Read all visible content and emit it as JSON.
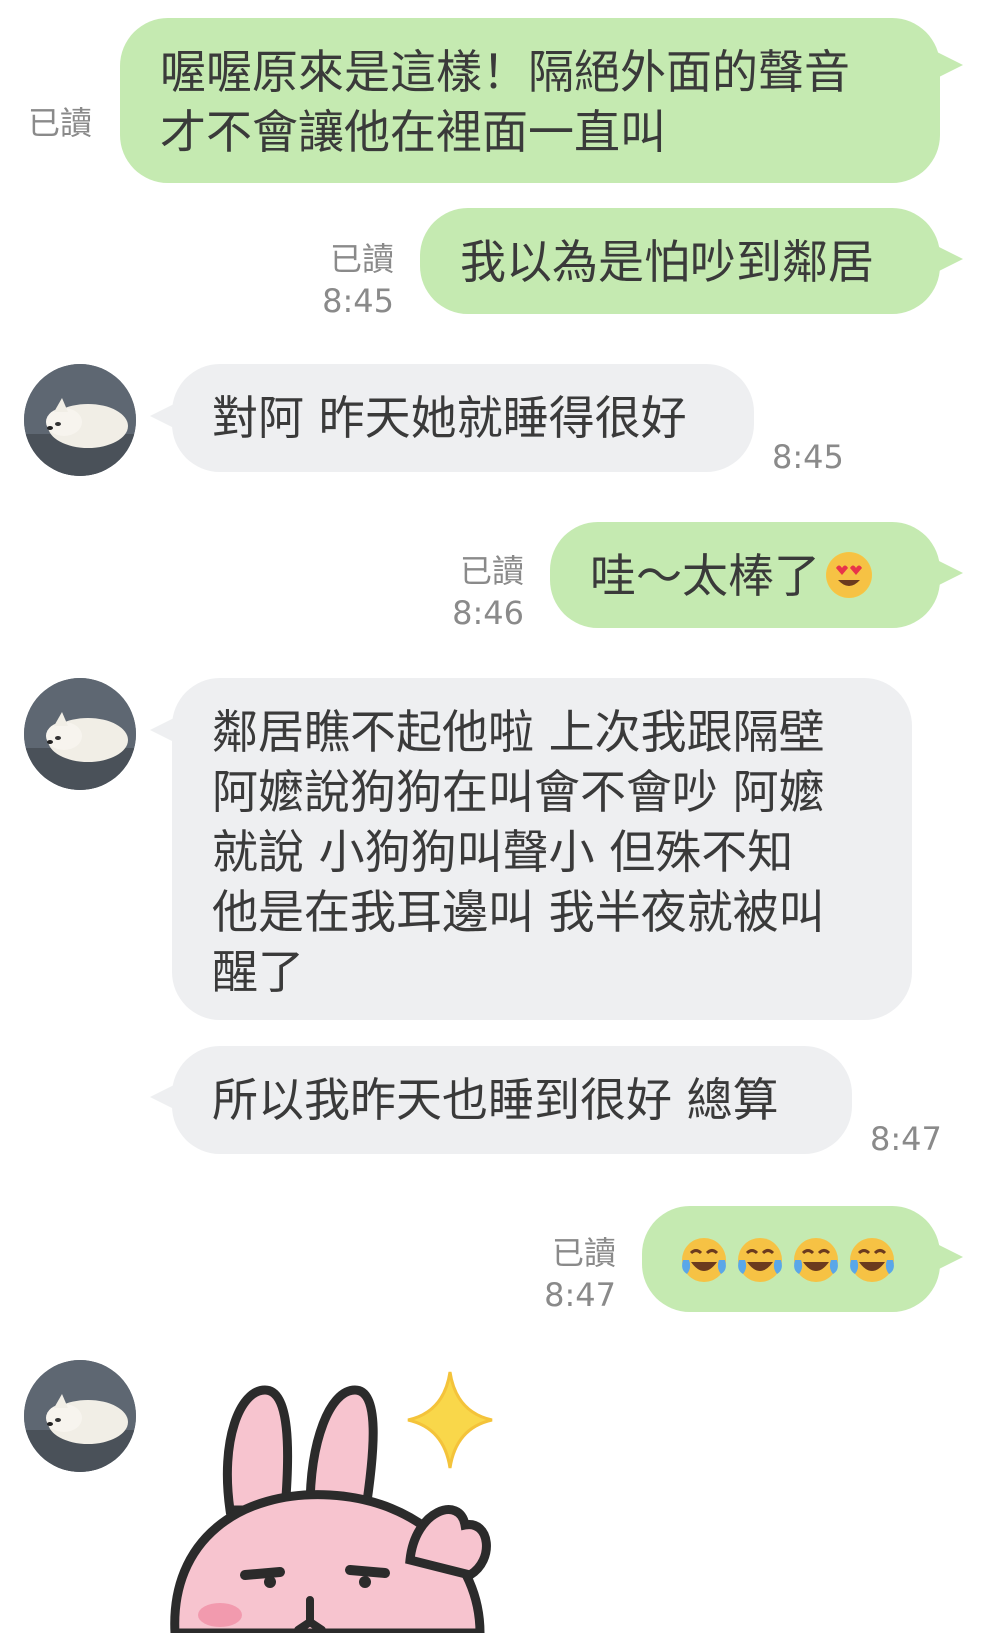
{
  "messages": [
    {
      "id": "m1",
      "dir": "out",
      "lines": [
        "喔喔原來是這樣！隔絕外面的聲音",
        "才不會讓他在裡面一直叫"
      ],
      "read": "已讀",
      "time": ""
    },
    {
      "id": "m2",
      "dir": "out",
      "lines": [
        "我以為是怕吵到鄰居"
      ],
      "read": "已讀",
      "time": "8:45"
    },
    {
      "id": "m3",
      "dir": "in",
      "lines": [
        "對阿 昨天她就睡得很好"
      ],
      "time": "8:45"
    },
    {
      "id": "m4",
      "dir": "out",
      "lines": [
        "哇～太棒了"
      ],
      "emoji": "heart-eyes-emoji",
      "read": "已讀",
      "time": "8:46"
    },
    {
      "id": "m5",
      "dir": "in",
      "lines": [
        "鄰居瞧不起他啦 上次我跟隔壁",
        "阿嬤說狗狗在叫會不會吵 阿嬤",
        "就說 小狗狗叫聲小 但殊不知",
        "他是在我耳邊叫 我半夜就被叫",
        "醒了"
      ],
      "time": ""
    },
    {
      "id": "m6",
      "dir": "in",
      "lines": [
        "所以我昨天也睡到很好 總算"
      ],
      "time": "8:47"
    },
    {
      "id": "m7",
      "dir": "out",
      "emoji": "tears-of-joy-emoji",
      "emoji_count": 4,
      "read": "已讀",
      "time": "8:47"
    }
  ],
  "colors": {
    "outgoing_bubble": "#c5eab1",
    "incoming_bubble": "#eeeff1",
    "meta_text": "#8a8a8a",
    "message_text": "#3a3a3a"
  },
  "icons": {
    "avatar": "dog-avatar",
    "sticker": "pink-bunny-sticker",
    "sparkle": "sparkle-icon"
  }
}
